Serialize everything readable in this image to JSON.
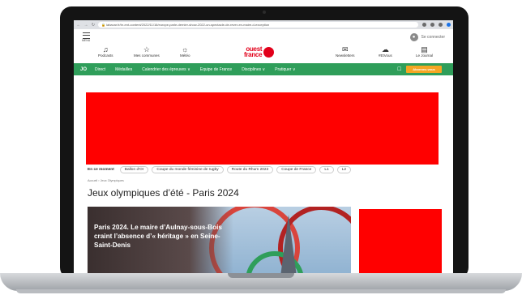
{
  "browser": {
    "url": "labavar.fr/br-ent-content/2022/11/16/europe-parle-dernier-show-2022-un-spectacle-de-rever-en-maire-d-exception"
  },
  "topbar": {
    "menu_label": "MENU",
    "login_label": "Se connecter"
  },
  "icons_row": {
    "items": [
      {
        "label": "Podcasts",
        "icon": "headphones-icon"
      },
      {
        "label": "Mes communes",
        "icon": "star-icon"
      },
      {
        "label": "Météo",
        "icon": "weather-icon"
      },
      {
        "label": "Newsletters",
        "icon": "mail-icon"
      },
      {
        "label": "#EtVous",
        "icon": "chat-icon"
      },
      {
        "label": "Le Journal",
        "icon": "newspaper-icon"
      }
    ],
    "logo_line1": "ouest",
    "logo_line2": "france"
  },
  "green_nav": {
    "jo": "JO",
    "items": [
      "Direct",
      "Médailles",
      "Calendrier des épreuves ∨",
      "Equipe de France",
      "Disciplines ∨",
      "Pratiquer ∨"
    ],
    "subscribe": "Abonnez-vous"
  },
  "trending": {
    "label": "En ce moment",
    "tags": [
      "Ballon d'Or",
      "Coupe du monde féminine de rugby",
      "Route du Rhum 2022",
      "Coupe de France",
      "L1",
      "L2"
    ]
  },
  "breadcrumb": "Accueil  ›  Jeux Olympiques",
  "page_title": "Jeux olympiques d’été - Paris 2024",
  "hero": {
    "title": "Paris 2024. Le maire d’Aulnay-sous-Bois craint l’absence d’« héritage » en Seine-Saint-Denis"
  },
  "colors": {
    "green_nav": "#2f9e5a",
    "brand_red": "#e2001a",
    "ad_red": "#ff0000",
    "subscribe": "#f5a623"
  }
}
